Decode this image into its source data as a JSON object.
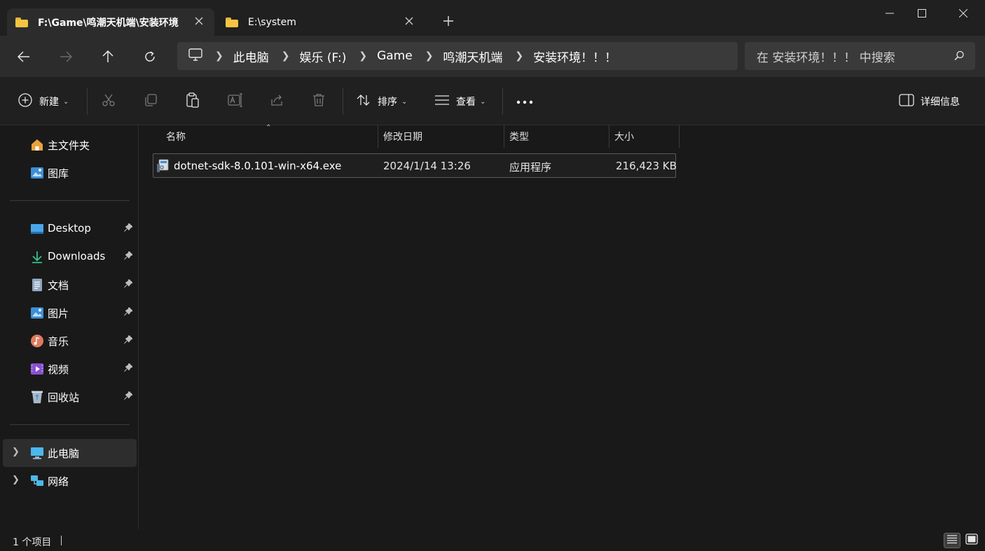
{
  "tabs": [
    {
      "label": "F:\\Game\\鸣潮天机端\\安装环境",
      "active": true
    },
    {
      "label": "E:\\system",
      "active": false
    }
  ],
  "address": {
    "crumbs": [
      "此电脑",
      "娱乐 (F:)",
      "Game",
      "鸣潮天机端",
      "安装环境！！！"
    ]
  },
  "search": {
    "placeholder": "在 安装环境！！！ 中搜索"
  },
  "toolbar": {
    "new_label": "新建",
    "sort_label": "排序",
    "view_label": "查看",
    "details_label": "详细信息"
  },
  "sidebar": {
    "top": [
      {
        "label": "主文件夹",
        "icon": "home-icon"
      },
      {
        "label": "图库",
        "icon": "gallery-icon"
      }
    ],
    "pinned": [
      {
        "label": "Desktop",
        "icon": "desktop-icon"
      },
      {
        "label": "Downloads",
        "icon": "downloads-icon"
      },
      {
        "label": "文档",
        "icon": "documents-icon"
      },
      {
        "label": "图片",
        "icon": "pictures-icon"
      },
      {
        "label": "音乐",
        "icon": "music-icon"
      },
      {
        "label": "视频",
        "icon": "videos-icon"
      },
      {
        "label": "回收站",
        "icon": "recycle-bin-icon"
      }
    ],
    "tree": [
      {
        "label": "此电脑",
        "icon": "this-pc-icon",
        "selected": true
      },
      {
        "label": "网络",
        "icon": "network-icon",
        "selected": false
      }
    ]
  },
  "columns": [
    "名称",
    "修改日期",
    "类型",
    "大小"
  ],
  "files": [
    {
      "name": "dotnet-sdk-8.0.101-win-x64.exe",
      "modified": "2024/1/14 13:26",
      "type": "应用程序",
      "size": "216,423 KB"
    }
  ],
  "status": {
    "item_count": "1 个项目"
  },
  "colors": {
    "accent": "#4cc2ff",
    "folder": "#f5c542",
    "background": "#191919"
  }
}
